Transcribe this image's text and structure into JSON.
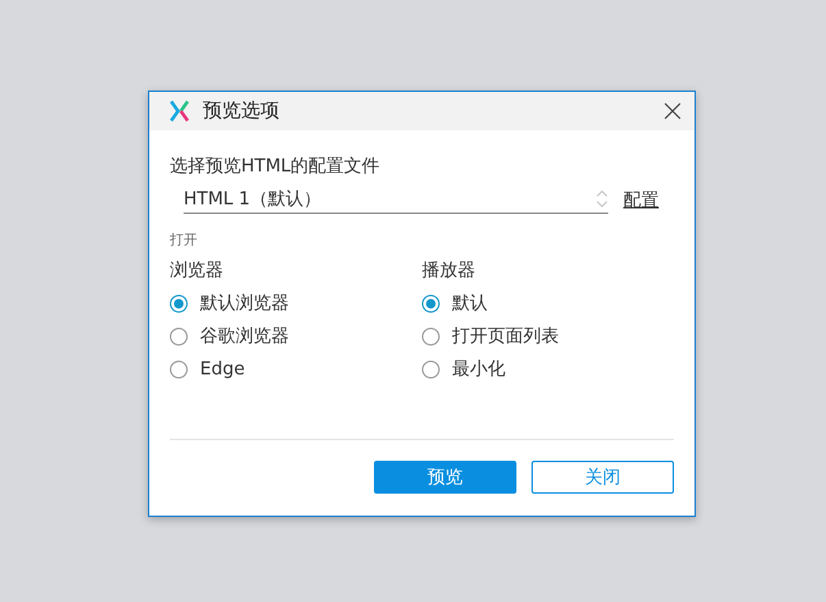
{
  "window": {
    "title": "预览选项"
  },
  "profile": {
    "label": "选择预览HTML的配置文件",
    "value": "HTML 1（默认）",
    "link": "配置"
  },
  "open_section": {
    "label": "打开"
  },
  "groups": [
    {
      "title": "浏览器",
      "options": [
        {
          "label": "默认浏览器",
          "selected": true
        },
        {
          "label": "谷歌浏览器",
          "selected": false
        },
        {
          "label": "Edge",
          "selected": false
        }
      ]
    },
    {
      "title": "播放器",
      "options": [
        {
          "label": "默认",
          "selected": true
        },
        {
          "label": "打开页面列表",
          "selected": false
        },
        {
          "label": "最小化",
          "selected": false
        }
      ]
    }
  ],
  "buttons": [
    {
      "label": "预览",
      "kind": "primary"
    },
    {
      "label": "关闭",
      "kind": "secondary"
    }
  ]
}
